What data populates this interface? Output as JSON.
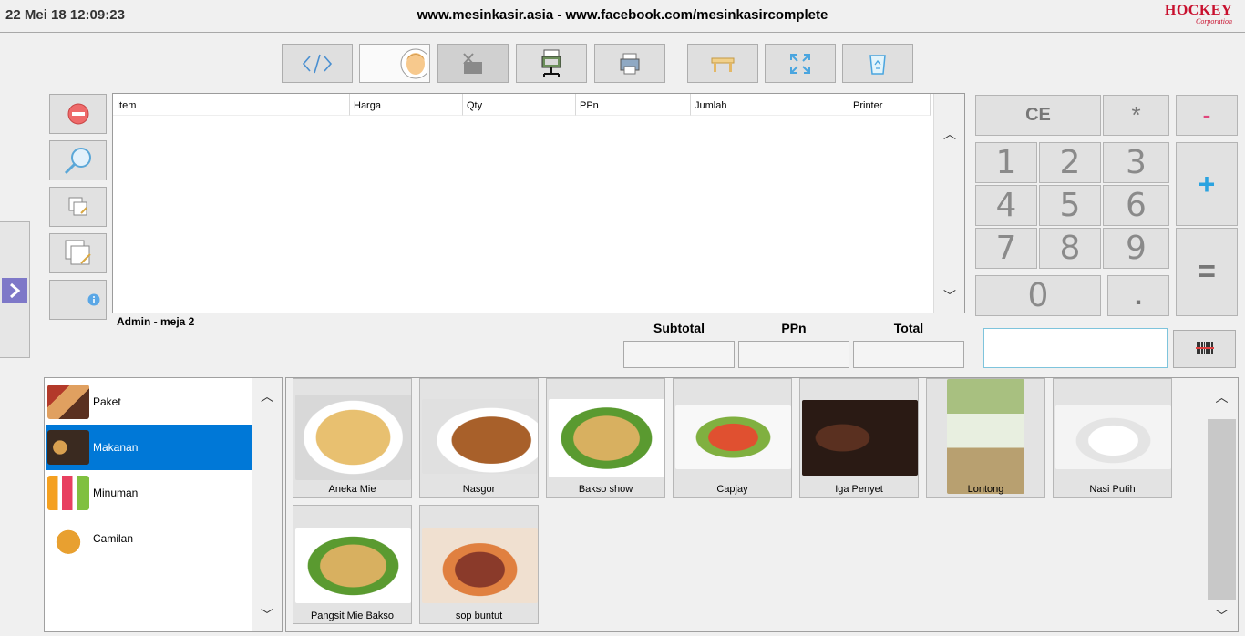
{
  "header": {
    "datetime": "22 Mei 18 12:09:23",
    "site": "www.mesinkasir.asia - www.facebook.com/mesinkasircomplete",
    "logo_main": "HOCKEY",
    "logo_sub": "Corporation"
  },
  "toolbar": [
    {
      "name": "code",
      "icon": "code-icon"
    },
    {
      "name": "user",
      "icon": "user-avatar-icon"
    },
    {
      "name": "cut",
      "icon": "cut-icon"
    },
    {
      "name": "network-printer",
      "icon": "network-printer-icon"
    },
    {
      "name": "printer",
      "icon": "printer-icon"
    },
    {
      "name": "table",
      "icon": "table-icon"
    },
    {
      "name": "fullscreen",
      "icon": "fullscreen-icon"
    },
    {
      "name": "recycle",
      "icon": "recycle-bin-icon"
    }
  ],
  "side_buttons": [
    "remove-icon",
    "search-icon",
    "copy-edit-icon",
    "duplicate-edit-icon",
    "info-icon"
  ],
  "table": {
    "columns": [
      "Item",
      "Harga",
      "Qty",
      "PPn",
      "Jumlah",
      "Printer"
    ],
    "rows": []
  },
  "status_text": "Admin - meja 2",
  "totals": {
    "subtotal_label": "Subtotal",
    "ppn_label": "PPn",
    "total_label": "Total",
    "subtotal_value": "",
    "ppn_value": "",
    "total_value": ""
  },
  "keypad": {
    "ce": "CE",
    "star": "*",
    "minus": "-",
    "plus": "+",
    "equals": "=",
    "dot": ".",
    "digits": [
      "1",
      "2",
      "3",
      "4",
      "5",
      "6",
      "7",
      "8",
      "9",
      "0"
    ]
  },
  "scan_input": {
    "value": ""
  },
  "categories": [
    {
      "label": "Paket",
      "selected": false
    },
    {
      "label": "Makanan",
      "selected": true
    },
    {
      "label": "Minuman",
      "selected": false
    },
    {
      "label": "Camilan",
      "selected": false
    }
  ],
  "products": [
    {
      "label": "Aneka Mie"
    },
    {
      "label": "Nasgor"
    },
    {
      "label": "Bakso show"
    },
    {
      "label": "Capjay"
    },
    {
      "label": "Iga Penyet"
    },
    {
      "label": "Lontong"
    },
    {
      "label": "Nasi Putih"
    },
    {
      "label": "Pangsit Mie Bakso"
    },
    {
      "label": "sop buntut"
    }
  ],
  "colors": {
    "accent": "#0078d7",
    "minus": "#e0457b",
    "plus": "#2ba3e0",
    "logo": "#c8102e",
    "handle": "#7e78c8"
  }
}
